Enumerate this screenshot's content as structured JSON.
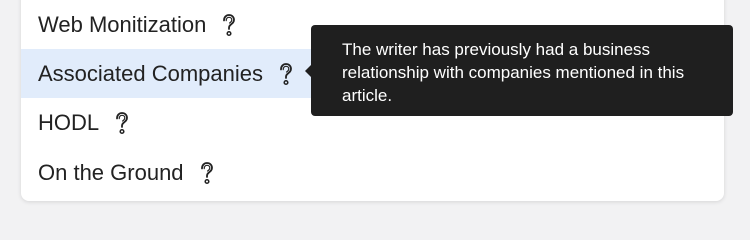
{
  "menu": {
    "items": [
      {
        "label": "Web Monitization",
        "icon": "question-mark-icon",
        "active": false
      },
      {
        "label": "Associated Companies",
        "icon": "question-mark-icon",
        "active": true
      },
      {
        "label": "HODL",
        "icon": "question-mark-icon",
        "active": false
      },
      {
        "label": "On the Ground",
        "icon": "question-mark-icon",
        "active": false
      }
    ]
  },
  "tooltip": {
    "text": "The writer has previously had a business relationship with companies mentioned in this article."
  },
  "colors": {
    "active_row_bg": "#e1ecfb",
    "tooltip_bg": "#1f1f1f",
    "text": "#222222"
  }
}
